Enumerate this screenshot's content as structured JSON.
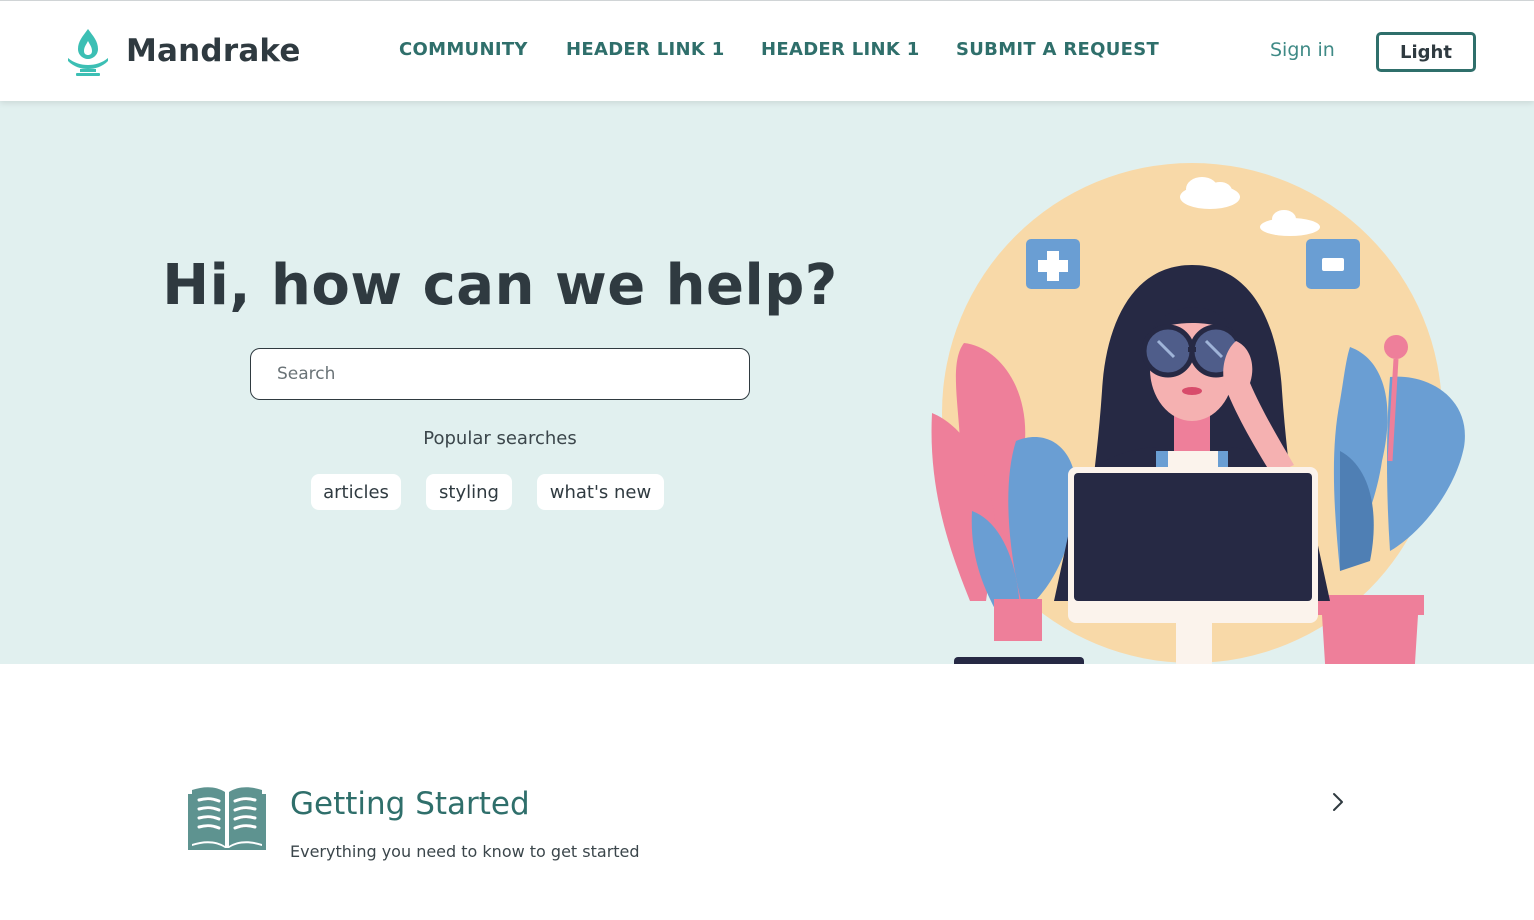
{
  "header": {
    "brand_name": "Mandrake",
    "logo_icon": "lamp-flame-icon",
    "nav": [
      "COMMUNITY",
      "HEADER LINK 1",
      "HEADER LINK 1",
      "SUBMIT A REQUEST"
    ],
    "sign_in": "Sign in",
    "theme_toggle": "Light"
  },
  "hero": {
    "title": "Hi, how can we help?",
    "search_placeholder": "Search",
    "popular_label": "Popular searches",
    "popular_searches": [
      "articles",
      "styling",
      "what's new"
    ],
    "illustration": "woman-with-sunglasses-at-computer-illustration"
  },
  "categories": [
    {
      "icon": "open-book-icon",
      "title": "Getting Started",
      "description": "Everything you need to know to get started",
      "action_icon": "chevron-right-icon"
    }
  ],
  "colors": {
    "accent": "#2f6f6b",
    "brand_teal": "#3cbfb4",
    "hero_background": "#e1f0ef",
    "text_dark": "#2f3a40"
  }
}
